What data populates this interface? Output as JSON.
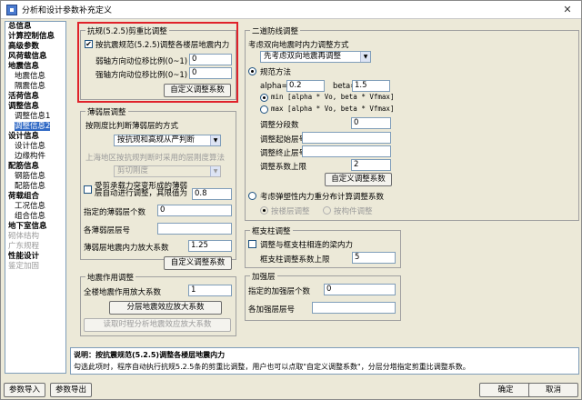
{
  "window": {
    "title": "分析和设计参数补充定义",
    "close_glyph": "✕"
  },
  "sidebar": {
    "items": [
      {
        "label": "总信息",
        "level": 0
      },
      {
        "label": "计算控制信息",
        "level": 0
      },
      {
        "label": "高级参数",
        "level": 0
      },
      {
        "label": "风荷载信息",
        "level": 0
      },
      {
        "label": "地震信息",
        "level": 0
      },
      {
        "label": "地震信息",
        "level": 1
      },
      {
        "label": "隔震信息",
        "level": 1
      },
      {
        "label": "活荷信息",
        "level": 0
      },
      {
        "label": "调整信息",
        "level": 0
      },
      {
        "label": "调整信息1",
        "level": 1
      },
      {
        "label": "调整信息2",
        "level": 1,
        "selected": true
      },
      {
        "label": "设计信息",
        "level": 0
      },
      {
        "label": "设计信息",
        "level": 1
      },
      {
        "label": "边缘构件",
        "level": 1
      },
      {
        "label": "配筋信息",
        "level": 0
      },
      {
        "label": "钢筋信息",
        "level": 1
      },
      {
        "label": "配筋信息",
        "level": 1
      },
      {
        "label": "荷载组合",
        "level": 0
      },
      {
        "label": "工况信息",
        "level": 1
      },
      {
        "label": "组合信息",
        "level": 1
      },
      {
        "label": "地下室信息",
        "level": 0
      },
      {
        "label": "砌体结构",
        "level": 0,
        "disabled": true
      },
      {
        "label": "广东规程",
        "level": 0,
        "disabled": true
      },
      {
        "label": "性能设计",
        "level": 0
      },
      {
        "label": "鉴定加固",
        "level": 0,
        "disabled": true
      }
    ]
  },
  "seismic_ratio": {
    "title": "抗规(5.2.5)剪重比调整",
    "checkbox_label": "按抗震规范(5.2.5)调整各楼层地震内力",
    "checked": true,
    "weak_axis_label": "弱轴方向动位移比例(0~1)",
    "weak_axis_value": "0",
    "strong_axis_label": "强轴方向动位移比例(0~1)",
    "strong_axis_value": "0",
    "custom_button": "自定义调整系数"
  },
  "weak_layer": {
    "title": "薄弱层调整",
    "method_label": "按刚度比判断薄弱层的方式",
    "method_value": "按抗规和高规从严判断",
    "shanghai_label": "上海地区按抗规判断时采用的层刚度算法",
    "shanghai_value": "剪切刚度",
    "transfer_checkbox_line1": "受剪承载力突变形成的薄弱",
    "transfer_checkbox_line2": "层自动进行调整，其限值为",
    "transfer_value": "0.8",
    "specified_label": "指定的薄弱层个数",
    "specified_value": "0",
    "floor_label": "各薄弱层层号",
    "floor_value": "",
    "amplify_label": "薄弱层地震内力放大系数",
    "amplify_value": "1.25",
    "custom_button": "自定义调整系数"
  },
  "seismic_action": {
    "title": "地震作用调整",
    "global_label": "全楼地震作用放大系数",
    "global_value": "1",
    "floor_button": "分层地震效应放大系数",
    "read_button": "读取时程分析地震效应放大系数"
  },
  "second_defense": {
    "title": "二道防线调整",
    "consider_label": "考虑双向地震时内力调整方式",
    "consider_value": "先考虑双向地震再调整",
    "standard_label": "规范方法",
    "alpha_label": "alpha=",
    "alpha_value": "0.2",
    "beta_label": "beta=",
    "beta_value": "1.5",
    "min_label": "min [alpha * Vo, beta * Vfmax]",
    "max_label": "max [alpha * Vo, beta * Vfmax]",
    "segments_label": "调整分段数",
    "segments_value": "0",
    "start_label": "调整起始层号",
    "start_value": "",
    "end_label": "调整终止层号",
    "end_value": "",
    "upper_label": "调整系数上限",
    "upper_value": "2",
    "custom_button": "自定义调整系数",
    "elastoplastic_label": "考虑弹塑性内力重分布计算调整系数",
    "by_floor_label": "按楼层调整",
    "by_member_label": "按构件调整"
  },
  "frame_beam": {
    "title": "框支柱调整",
    "checkbox_label": "调整与框支柱相连的梁内力",
    "upper_label": "框支柱调整系数上限",
    "upper_value": "5"
  },
  "strengthen": {
    "title": "加强层",
    "count_label": "指定的加强层个数",
    "count_value": "0",
    "floor_label": "各加强层层号",
    "floor_value": ""
  },
  "description": {
    "heading": "说明：按抗震规范(5.2.5)调整各楼层地震内力",
    "body": "勾选此项时，程序自动执行抗规5.2.5条的剪重比调整，用户也可以点取\"自定义调整系数\"，分层分塔指定剪重比调整系数。"
  },
  "bottom": {
    "import_label": "参数导入",
    "export_label": "参数导出",
    "ok_label": "确定",
    "cancel_label": "取消"
  },
  "colors": {
    "highlight": "#e0222a",
    "selection": "#316ac5",
    "dialog_bg": "#ece9d8"
  }
}
